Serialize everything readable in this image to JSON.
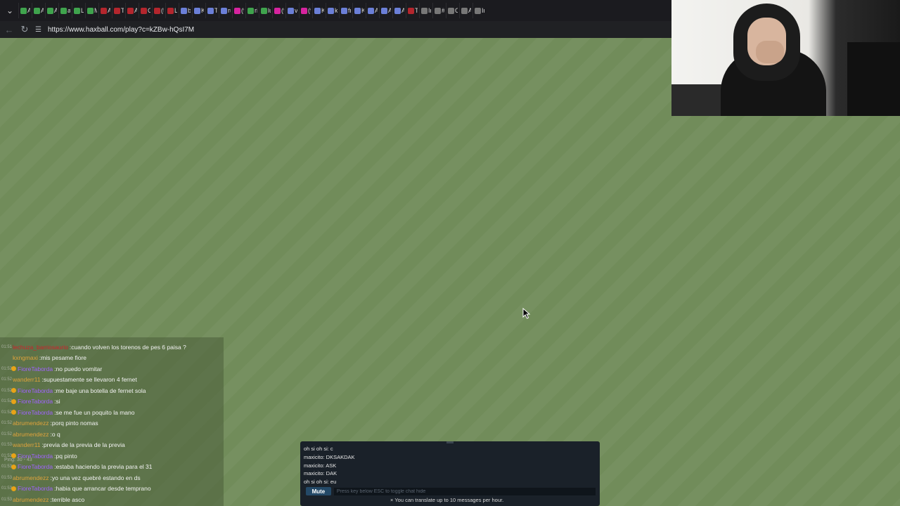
{
  "browser": {
    "url": "https://www.haxball.com/play?c=kZBw-hQsI7M",
    "tabs": [
      {
        "label": "Al",
        "color": "#3fa34d"
      },
      {
        "label": "Al",
        "color": "#3fa34d"
      },
      {
        "label": "Al",
        "color": "#3fa34d"
      },
      {
        "label": "a!",
        "color": "#3fa34d"
      },
      {
        "label": "Lu",
        "color": "#3fa34d"
      },
      {
        "label": "M",
        "color": "#3fa34d"
      },
      {
        "label": "Al",
        "color": "#b3262d"
      },
      {
        "label": "Tr",
        "color": "#b3262d"
      },
      {
        "label": "Al",
        "color": "#b3262d"
      },
      {
        "label": "C",
        "color": "#b3262d"
      },
      {
        "label": "(5",
        "color": "#b3262d"
      },
      {
        "label": "LC",
        "color": "#b3262d"
      },
      {
        "label": "bi",
        "color": "#6b7fd7"
      },
      {
        "label": "K",
        "color": "#6b7fd7"
      },
      {
        "label": "Tl",
        "color": "#6b7fd7"
      },
      {
        "label": "ru",
        "color": "#6b7fd7"
      },
      {
        "label": "(9",
        "color": "#d6249f"
      },
      {
        "label": "ri",
        "color": "#3fa34d"
      },
      {
        "label": "lu",
        "color": "#3fa34d"
      },
      {
        "label": "(9",
        "color": "#d6249f"
      },
      {
        "label": "vi",
        "color": "#6b7fd7"
      },
      {
        "label": "(9",
        "color": "#d6249f"
      },
      {
        "label": "K",
        "color": "#6b7fd7"
      },
      {
        "label": "ki",
        "color": "#6b7fd7"
      },
      {
        "label": "fr",
        "color": "#6b7fd7"
      },
      {
        "label": "K",
        "color": "#6b7fd7"
      },
      {
        "label": "A",
        "color": "#6b7fd7"
      },
      {
        "label": "A",
        "color": "#6b7fd7"
      },
      {
        "label": "A",
        "color": "#6b7fd7"
      },
      {
        "label": "Tr",
        "color": "#b3262d"
      },
      {
        "label": "Ir",
        "color": "#777777"
      },
      {
        "label": "#",
        "color": "#777777"
      },
      {
        "label": "C",
        "color": "#777777"
      },
      {
        "label": "A",
        "color": "#777777"
      },
      {
        "label": "Ir",
        "color": "#777777"
      }
    ]
  },
  "twitch_chat": [
    {
      "time": "01:51",
      "user": "lechuza_barriosaurio",
      "user_color": "#d11f2a",
      "badge": false,
      "msg": "cuando volven los torenos de pes 6 paisa ?"
    },
    {
      "time": "",
      "user": "kxngmaxi",
      "user_color": "#e0a33b",
      "badge": false,
      "msg": "mis pesame fiore"
    },
    {
      "time": "01:52",
      "user": "FioreTaborda",
      "user_color": "#9f62ff",
      "badge": true,
      "msg": "no puedo vomitar"
    },
    {
      "time": "01:52",
      "user": "wanderr11",
      "user_color": "#e0a33b",
      "badge": false,
      "msg": "supuestamente se llevaron 4 fernet"
    },
    {
      "time": "01:52",
      "user": "FioreTaborda",
      "user_color": "#9f62ff",
      "badge": true,
      "msg": "me baje una botella de fernet sola"
    },
    {
      "time": "01:52",
      "user": "FioreTaborda",
      "user_color": "#9f62ff",
      "badge": true,
      "msg": "si"
    },
    {
      "time": "01:52",
      "user": "FioreTaborda",
      "user_color": "#9f62ff",
      "badge": true,
      "msg": "se me fue un poquito la mano"
    },
    {
      "time": "01:52",
      "user": "abrumendezz",
      "user_color": "#e0a33b",
      "badge": false,
      "msg": "porq pinto nomas"
    },
    {
      "time": "01:52",
      "user": "abrumendezz",
      "user_color": "#e0a33b",
      "badge": false,
      "msg": "o q"
    },
    {
      "time": "01:53",
      "user": "wanderr11",
      "user_color": "#e0a33b",
      "badge": false,
      "msg": "previa de la previa de la previa"
    },
    {
      "time": "01:53",
      "user": "FioreTaborda",
      "user_color": "#9f62ff",
      "badge": true,
      "msg": "pq pinto"
    },
    {
      "time": "01:53",
      "user": "FioreTaborda",
      "user_color": "#9f62ff",
      "badge": true,
      "msg": "estaba haciendo la previa para el 31"
    },
    {
      "time": "01:53",
      "user": "abrumendezz",
      "user_color": "#e0a33b",
      "badge": false,
      "msg": "yo una vez quebré estando en ds"
    },
    {
      "time": "01:53",
      "user": "FioreTaborda",
      "user_color": "#9f62ff",
      "badge": true,
      "msg": "habia que arrancar desde temprano"
    },
    {
      "time": "01:53",
      "user": "abrumendezz",
      "user_color": "#e0a33b",
      "badge": false,
      "msg": "terrible asco"
    }
  ],
  "ping_text": "Ping: 30 - 43",
  "room_chat": {
    "messages": [
      "oh si oh si: c",
      "maxicito: DKSAKDAK",
      "maxicito: ASK",
      "maxicito: DAK",
      "oh si oh si: eu"
    ],
    "mute_label": "Mute",
    "input_placeholder": "Press key below ESC to toggle chat hide",
    "translate_notice": "× You can translate up to 10 messages per hour."
  }
}
